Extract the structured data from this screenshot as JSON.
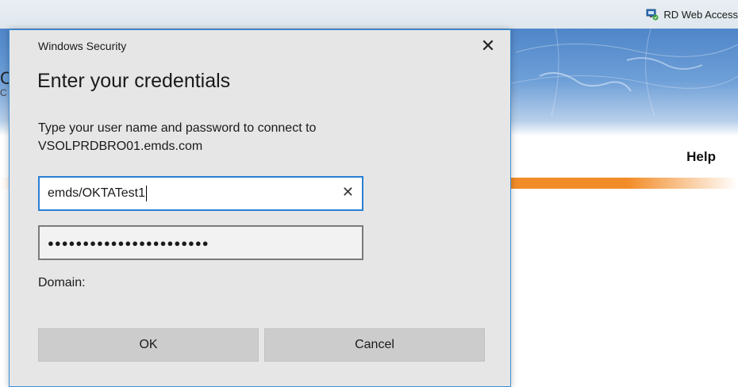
{
  "browser": {
    "rd_title": "RD Web Access",
    "rd_icon": "remote-desktop-icon"
  },
  "background_page": {
    "help_label": "Help",
    "accent_orange": "#f28c28",
    "banner_blue": "#4f86c9"
  },
  "dialog": {
    "title": "Windows Security",
    "heading": "Enter your credentials",
    "prompt": "Type your user name and password to connect to VSOLPRDBRO01.emds.com",
    "username_value": "emds/OKTATest1",
    "password_mask": "●●●●●●●●●●●●●●●●●●●●●●●",
    "domain_label": "Domain:",
    "ok_label": "OK",
    "cancel_label": "Cancel",
    "close_glyph": "✕",
    "clear_glyph": "✕",
    "border_color": "#3c8fd6"
  }
}
